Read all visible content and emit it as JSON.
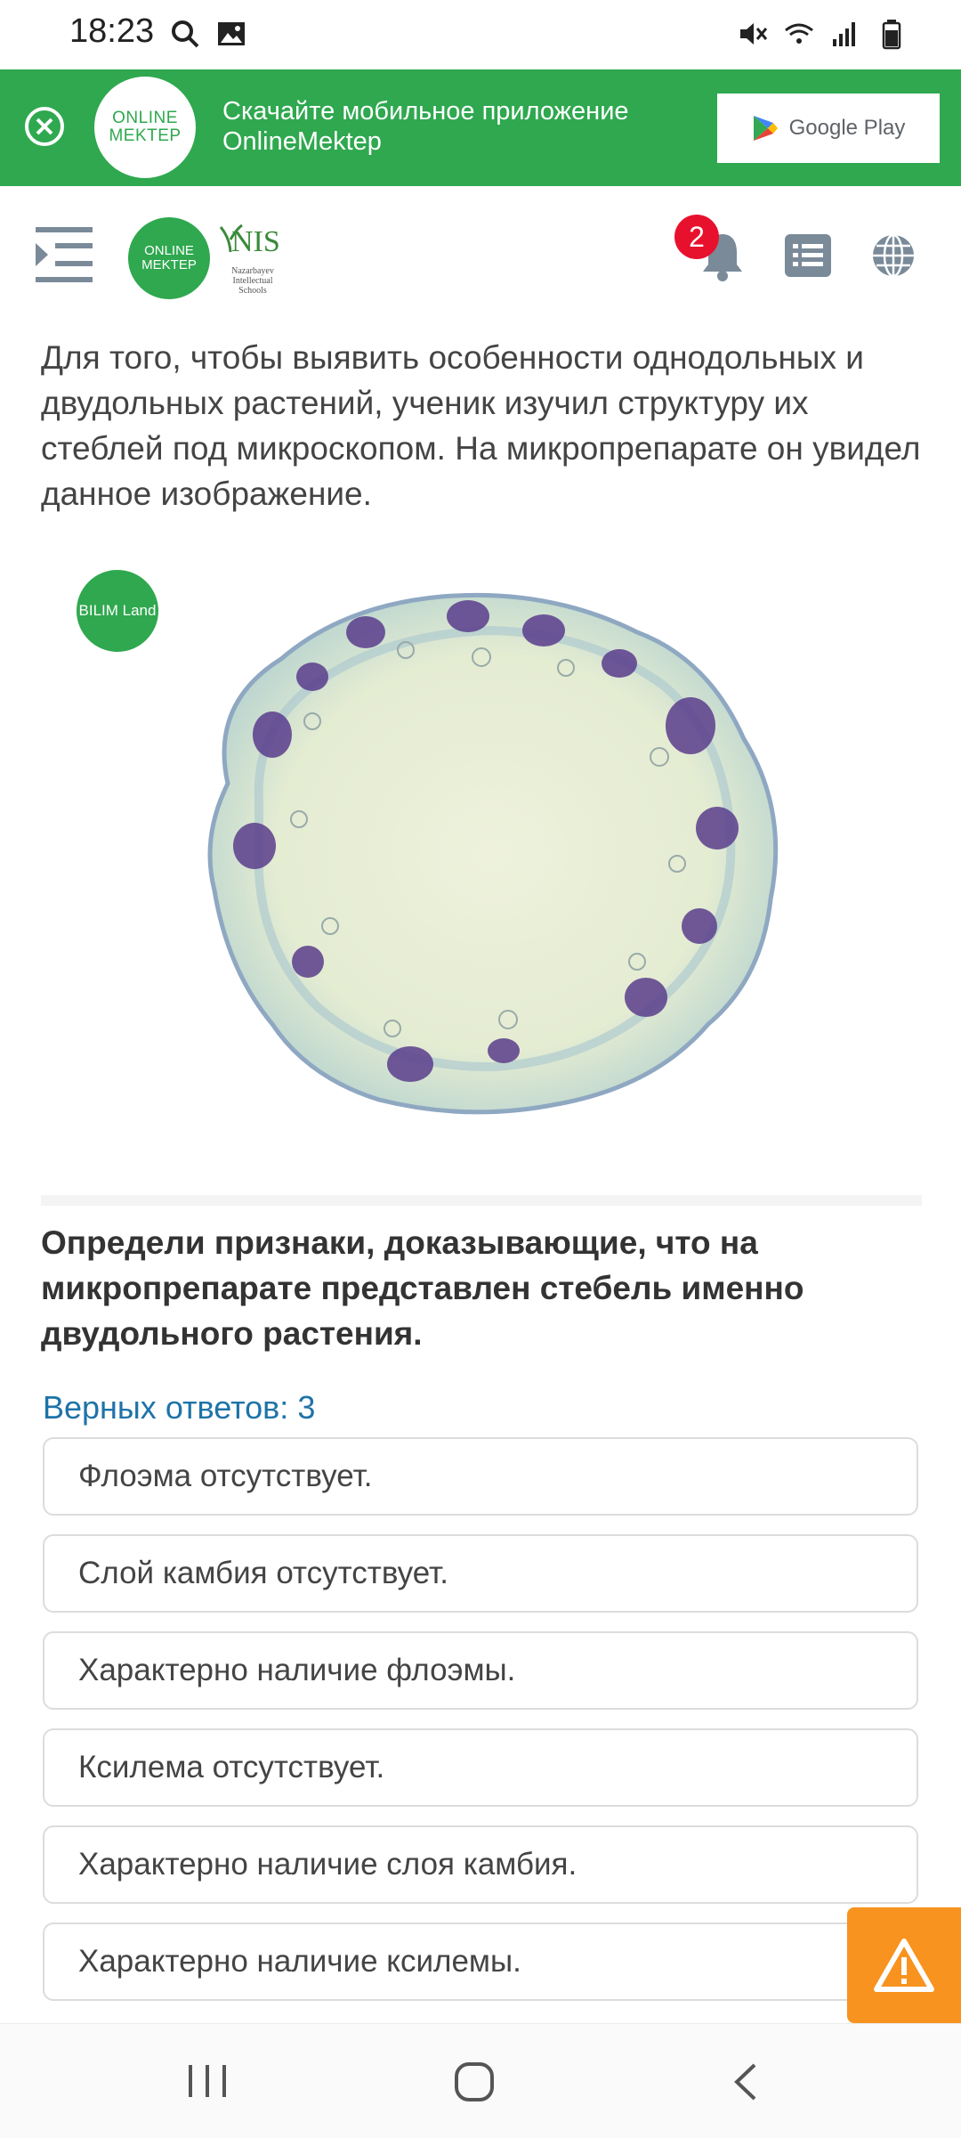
{
  "status_bar": {
    "time": "18:23",
    "left_icons": [
      "search-icon",
      "image-icon"
    ],
    "right_icons": [
      "mute-icon",
      "wifi-icon",
      "signal-icon",
      "battery-icon"
    ]
  },
  "banner": {
    "logo_text": "ONLINE MEKTEP",
    "text_line1": "Скачайте мобильное приложение",
    "text_line2": "OnlineMektep",
    "store_button": "Google Play",
    "accent": "#2fa84f"
  },
  "header": {
    "logo_text": "ONLINE MEKTEP",
    "partner_logo_title": "NIS",
    "partner_logo_subtitle": "Nazarbayev Intellectual Schools",
    "notifications_count": "2",
    "badge_color": "#e8112d"
  },
  "question": {
    "intro": "Для того, чтобы выявить особенности однодольных и двудольных растений, ученик изучил структуру их стеблей под микроскопом. На микропрепарате он увидел данное изображение.",
    "image_watermark": "BILIM Land",
    "task": "Определи признаки, доказывающие, что на микропрепарате представлен стебель именно двудольного растения.",
    "answers_count": "Верных ответов: 3",
    "options": [
      "Флоэма отсутствует.",
      "Слой камбия отсутствует.",
      "Характерно наличие флоэмы.",
      "Ксилема отсутствует.",
      "Характерно наличие слоя камбия.",
      "Характерно наличие ксилемы."
    ]
  },
  "report_button_color": "#f7931e",
  "nav_bar": [
    "recent-apps-icon",
    "home-icon",
    "back-icon"
  ]
}
